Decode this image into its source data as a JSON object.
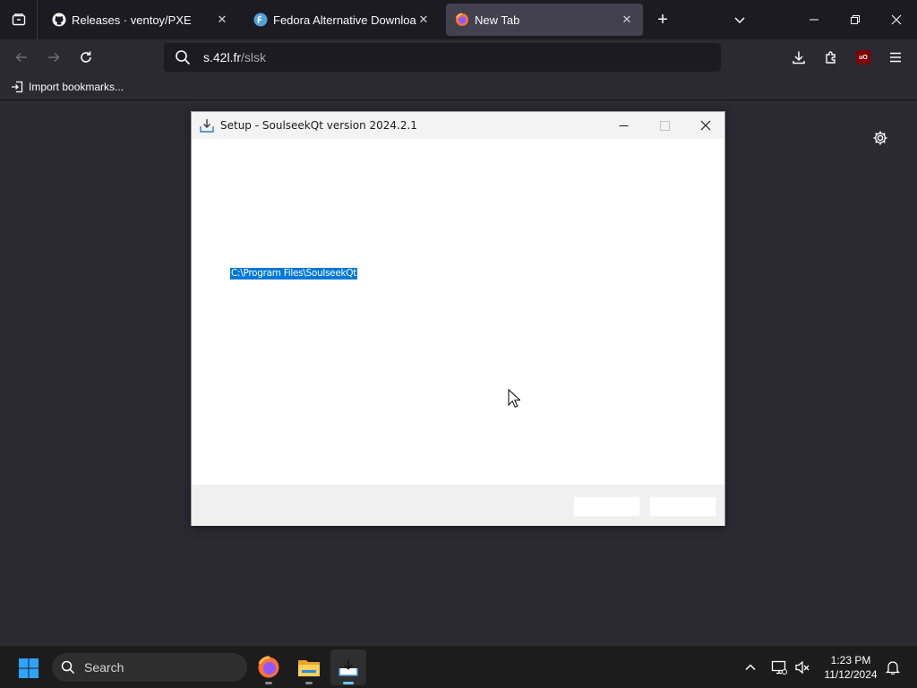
{
  "browser": {
    "tabs": [
      {
        "title": "Releases · ventoy/PXE",
        "favicon": "github-icon",
        "active": false
      },
      {
        "title": "Fedora Alternative Downloads",
        "favicon": "fedora-icon",
        "active": false
      },
      {
        "title": "New Tab",
        "favicon": "firefox-icon",
        "active": true
      }
    ],
    "url": {
      "host": "s.42l.fr",
      "path": "/slsk"
    },
    "bookmarks": [
      {
        "label": "Import bookmarks..."
      }
    ]
  },
  "dialog": {
    "title": "Setup - SoulseekQt version 2024.2.1",
    "install_path": "C:\\Program Files\\SoulseekQt",
    "buttons": [
      "",
      ""
    ]
  },
  "taskbar": {
    "search_label": "Search",
    "apps": [
      {
        "name": "firefox-icon",
        "active": false
      },
      {
        "name": "file-explorer-icon",
        "active": false
      },
      {
        "name": "setup-installer-icon",
        "active": true
      }
    ],
    "time": "1:23 PM",
    "date": "11/12/2024"
  },
  "colors": {
    "tab_strip": "#1c1b22",
    "toolbar": "#2b2a33",
    "active_tab": "#42414d",
    "selection": "#0078d7",
    "taskbar": "#1c1c1c",
    "ublock_red": "#800000"
  }
}
